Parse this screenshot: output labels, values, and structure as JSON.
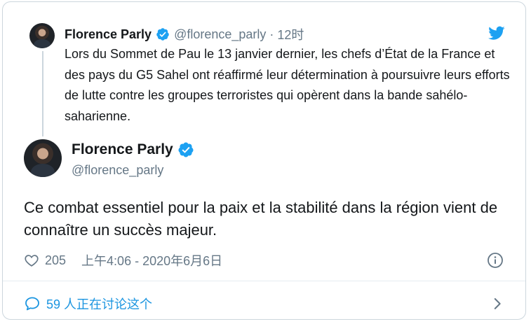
{
  "quoted": {
    "name": "Florence Parly",
    "handle": "@florence_parly",
    "separator": "·",
    "time": "12时",
    "text": "Lors du Sommet de Pau le 13 janvier dernier, les chefs d’État de la France et des pays du G5 Sahel ont réaffirmé leur détermination à poursuivre leurs efforts de lutte contre les groupes terroristes qui opèrent dans la bande sahélo-saharienne."
  },
  "main": {
    "name": "Florence Parly",
    "handle": "@florence_parly",
    "text": "Ce combat essentiel pour la paix et la stabilité dans la région vient de connaître un succès majeur.",
    "likes": "205",
    "timestamp": "上午4:06 - 2020年6月6日"
  },
  "footer": {
    "discussion": "59 人正在讨论这个"
  },
  "icons": {
    "verified": "verified-badge-icon",
    "twitter": "twitter-bird-icon",
    "heart": "heart-icon",
    "info": "info-icon",
    "bubble": "speech-bubble-icon",
    "chevron": "chevron-right-icon"
  },
  "colors": {
    "brand_blue": "#1da1f2",
    "link_blue": "#1b95e0",
    "secondary_text": "#657786",
    "border": "#ccd6dd"
  }
}
